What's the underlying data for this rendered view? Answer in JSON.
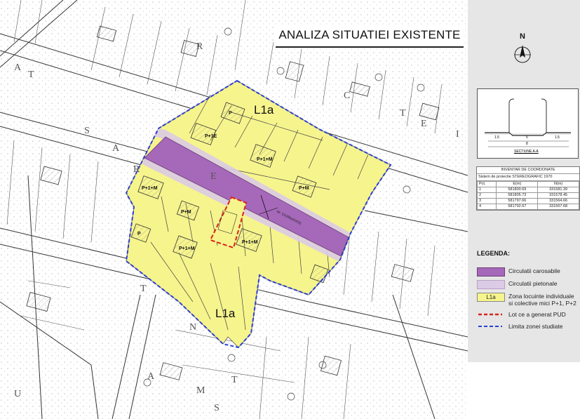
{
  "title": "ANALIZA SITUATIEI EXISTENTE",
  "north": {
    "label": "N",
    "icon": "north-arrow-icon"
  },
  "colors": {
    "carosabil": "#a668b9",
    "pietonal": "#dccbe4",
    "zona_l1a": "#f6f48d",
    "lot_pud": "#d8231a",
    "limita": "#2b3fd1"
  },
  "zone_labels": {
    "top": "L1a",
    "bottom": "L1a"
  },
  "street_label": "str. CIORNATATE",
  "building_labels": [
    "P",
    "P+1E",
    "P+1+M",
    "P+1+M",
    "P+M",
    "P+M",
    "P+1+M",
    "P+1+M",
    "P"
  ],
  "section": {
    "title": "SECTIUNE A-A",
    "dims": [
      "1.5",
      "5",
      "1.5",
      "8"
    ]
  },
  "inventory": {
    "title": "INVENTAR DE COORDONATE",
    "subtitle": "Sistem de proiectie STEREOGRAFIC 1970",
    "headers": [
      "Pct.",
      "E(m)",
      "N(m)"
    ],
    "rows": [
      [
        "1",
        "581800.69",
        "331581.39"
      ],
      [
        "2",
        "581805.73",
        "331578.45"
      ],
      [
        "3",
        "581797.66",
        "331564.66"
      ],
      [
        "4",
        "581792.67",
        "331567.68"
      ]
    ]
  },
  "legend": {
    "title": "LEGENDA:",
    "items": [
      {
        "label": "Circulatii carosabile"
      },
      {
        "label": "Circulatii pietonale"
      },
      {
        "swatch": "L1a",
        "label": "Zona locuinte individuale",
        "label2": "si colective mici P+1, P+2"
      },
      {
        "label": "Lot ce a generat PUD"
      },
      {
        "label": "Limita zonei studiate"
      }
    ]
  }
}
